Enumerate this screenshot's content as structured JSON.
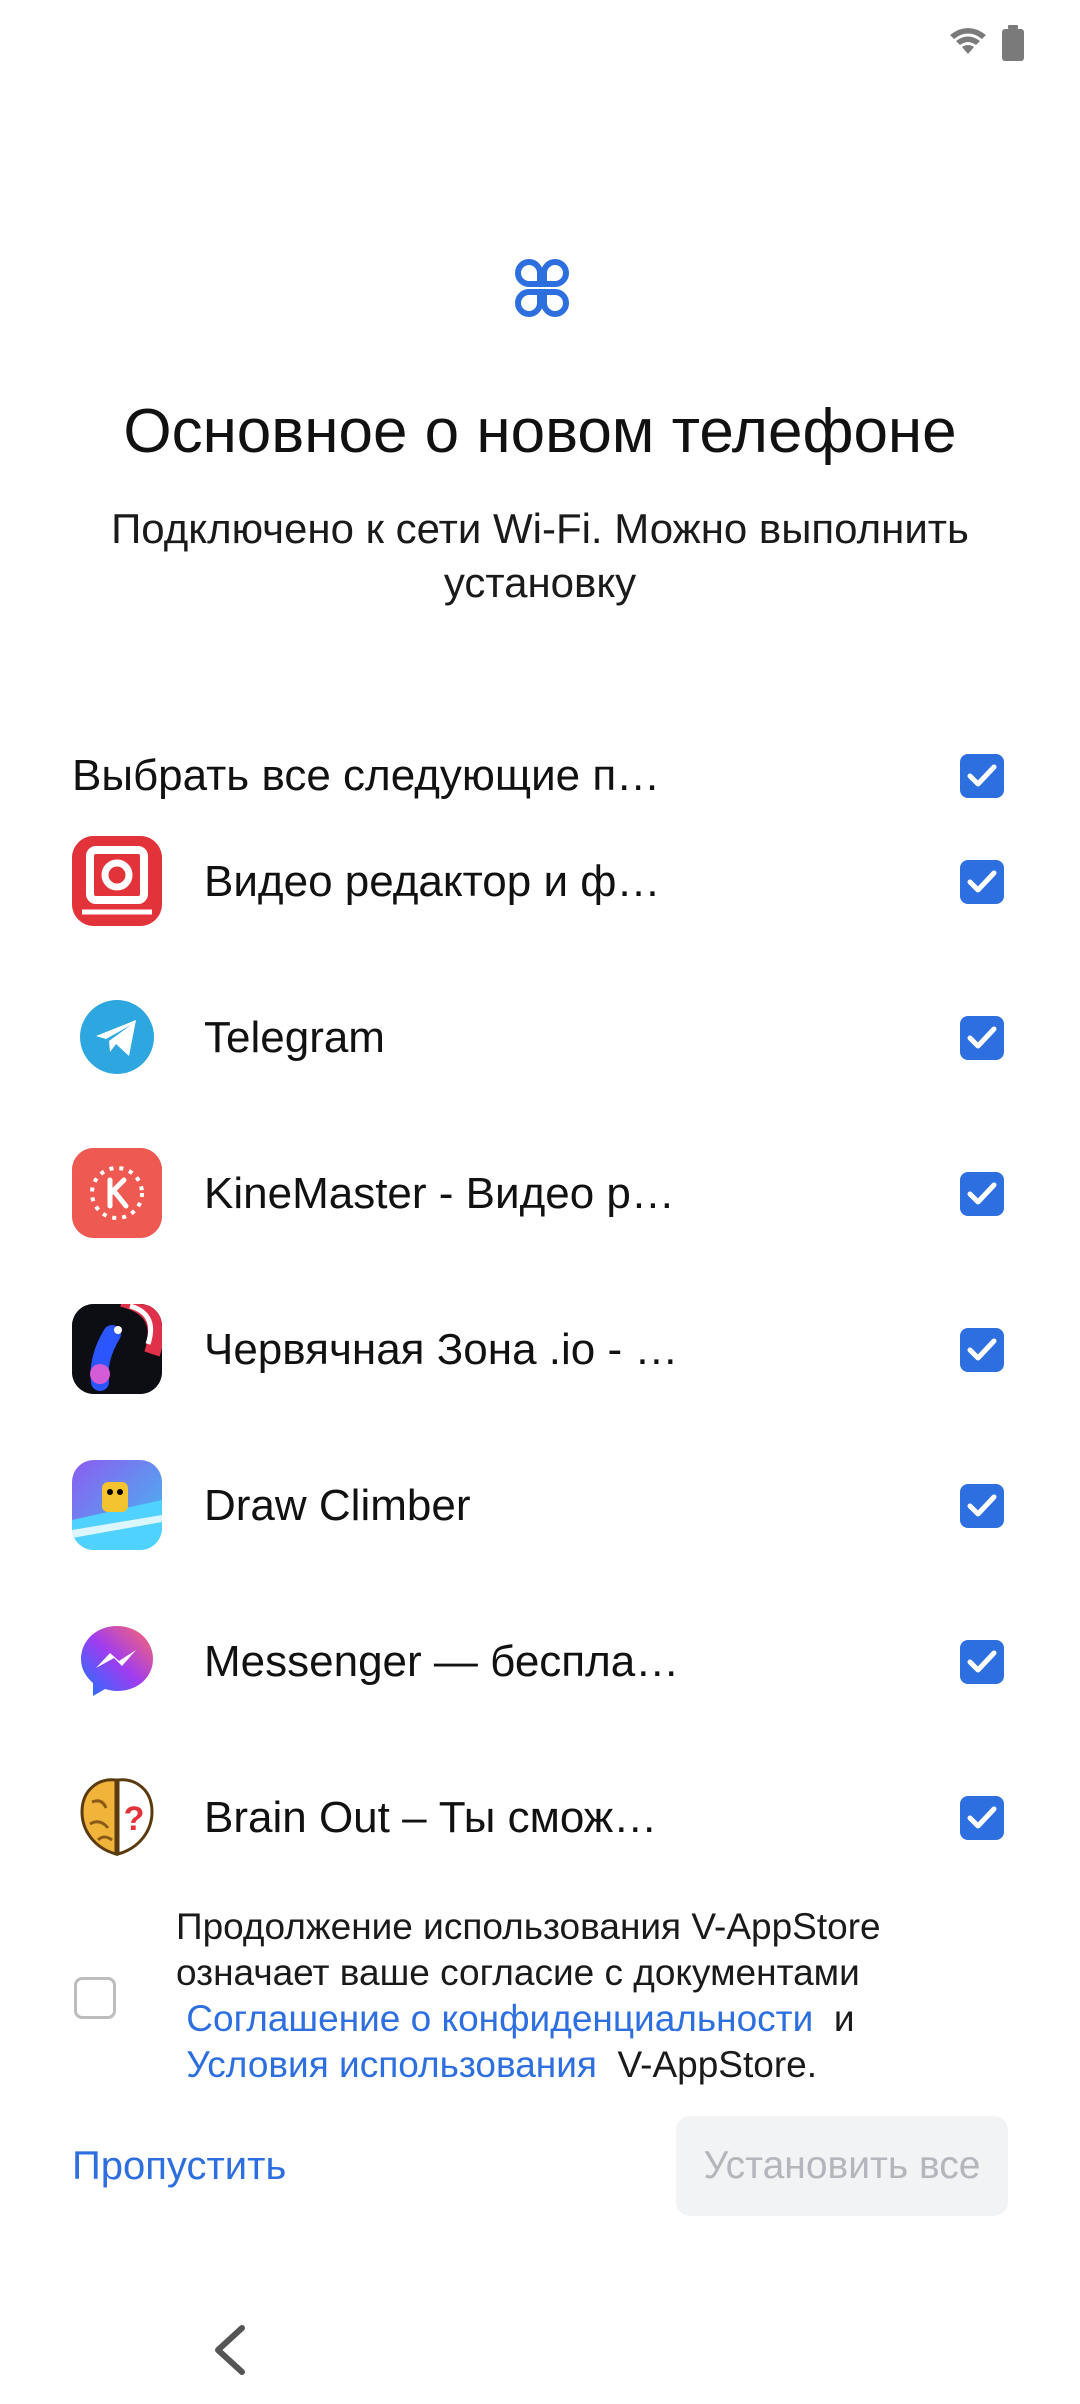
{
  "status_bar": {
    "icons": [
      "wifi-icon",
      "battery-icon"
    ]
  },
  "header": {
    "logo_icon": "app-logo-icon",
    "title": "Основное о новом телефоне",
    "subtitle": "Подключено к сети Wi-Fi. Можно выполнить установку"
  },
  "select_all": {
    "label": "Выбрать все следующие п…",
    "checked": true
  },
  "apps": [
    {
      "name": "Видео редактор  и ф…",
      "icon": "video-editor-icon",
      "checked": true
    },
    {
      "name": "Telegram",
      "icon": "telegram-icon",
      "checked": true
    },
    {
      "name": "KineMaster - Видео р…",
      "icon": "kinemaster-icon",
      "checked": true
    },
    {
      "name": "Червячная Зона .io - …",
      "icon": "worm-zone-icon",
      "checked": true
    },
    {
      "name": "Draw Climber",
      "icon": "draw-climber-icon",
      "checked": true
    },
    {
      "name": "Messenger — бесплa…",
      "icon": "messenger-icon",
      "checked": true
    },
    {
      "name": "Brain Out – Ты смож…",
      "icon": "brain-out-icon",
      "checked": true
    }
  ],
  "consent": {
    "checked": false,
    "text_before": "Продолжение использования V-AppStore означает ваше согласие с документами",
    "privacy_link": "Соглашение о конфиденциальности",
    "and": "и",
    "terms_link": "Условия использования",
    "text_after": "V-AppStore."
  },
  "footer": {
    "skip_label": "Пропустить",
    "install_label": "Установить все"
  },
  "nav": {
    "back_icon": "back-chevron-icon"
  },
  "colors": {
    "accent": "#2e6fe0",
    "disabled_bg": "#f2f3f5",
    "disabled_text": "#b3b6bb"
  }
}
